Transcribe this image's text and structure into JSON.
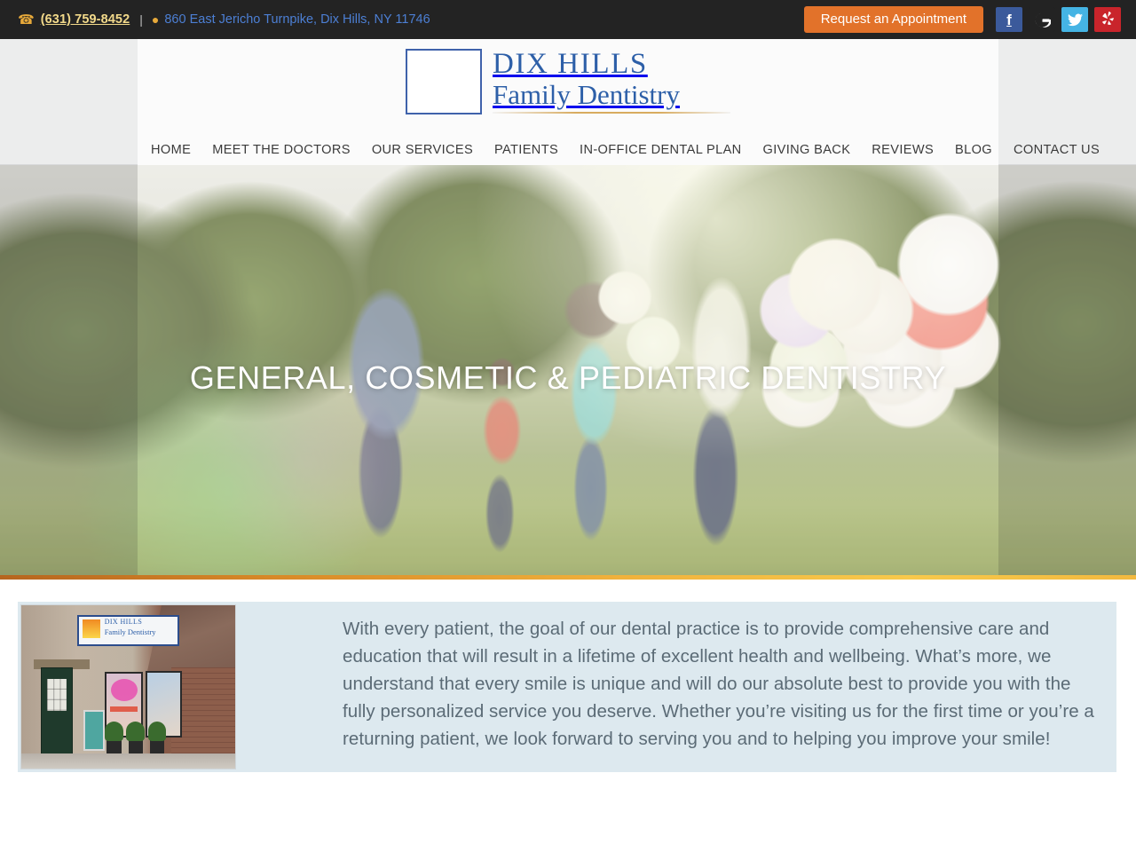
{
  "topbar": {
    "phone": "(631) 759-8452",
    "separator": "|",
    "address": "860 East Jericho Turnpike, Dix Hills, NY 11746",
    "appointment_button": "Request an Appointment",
    "socials": [
      {
        "name": "facebook",
        "glyph": "f",
        "color": "#3b5a9b"
      },
      {
        "name": "google",
        "glyph": "G",
        "color": "#232323"
      },
      {
        "name": "twitter",
        "glyph": "ᵕ",
        "color": "#45b4e4"
      },
      {
        "name": "yelp",
        "glyph": "✳",
        "color": "#c9242b"
      }
    ]
  },
  "logo": {
    "line1": "DIX HILLS",
    "line2": "Family Dentistry",
    "alt": "Dix Hills Family Dentistry logo"
  },
  "nav": {
    "items": [
      {
        "label": "HOME"
      },
      {
        "label": "MEET THE DOCTORS"
      },
      {
        "label": "OUR SERVICES"
      },
      {
        "label": "PATIENTS"
      },
      {
        "label": "IN-OFFICE DENTAL PLAN"
      },
      {
        "label": "GIVING BACK"
      },
      {
        "label": "REVIEWS"
      },
      {
        "label": "BLOG"
      },
      {
        "label": "CONTACT US"
      }
    ]
  },
  "hero": {
    "title": "GENERAL, COSMETIC & PEDIATRIC DENTISTRY"
  },
  "intro": {
    "photo_sign_line1": "DIX HILLS",
    "photo_sign_line2": "Family Dentistry",
    "paragraph": "With every patient, the goal of our dental practice is to provide comprehensive care and education that will result in a lifetime of excellent health and wellbeing. What’s more, we understand that every smile is unique and will do our absolute best to provide you with the fully personalized service you deserve. Whether you’re visiting us for the first time or you’re a returning patient, we look forward to serving you and to helping you improve your smile!"
  },
  "colors": {
    "accent_orange": "#e2722a",
    "brand_blue": "#2d5fa8",
    "topbar_bg": "#232323",
    "phone_gold": "#f2d98a",
    "link_blue": "#4c7fd4",
    "panel_blue": "#dde9ef"
  }
}
